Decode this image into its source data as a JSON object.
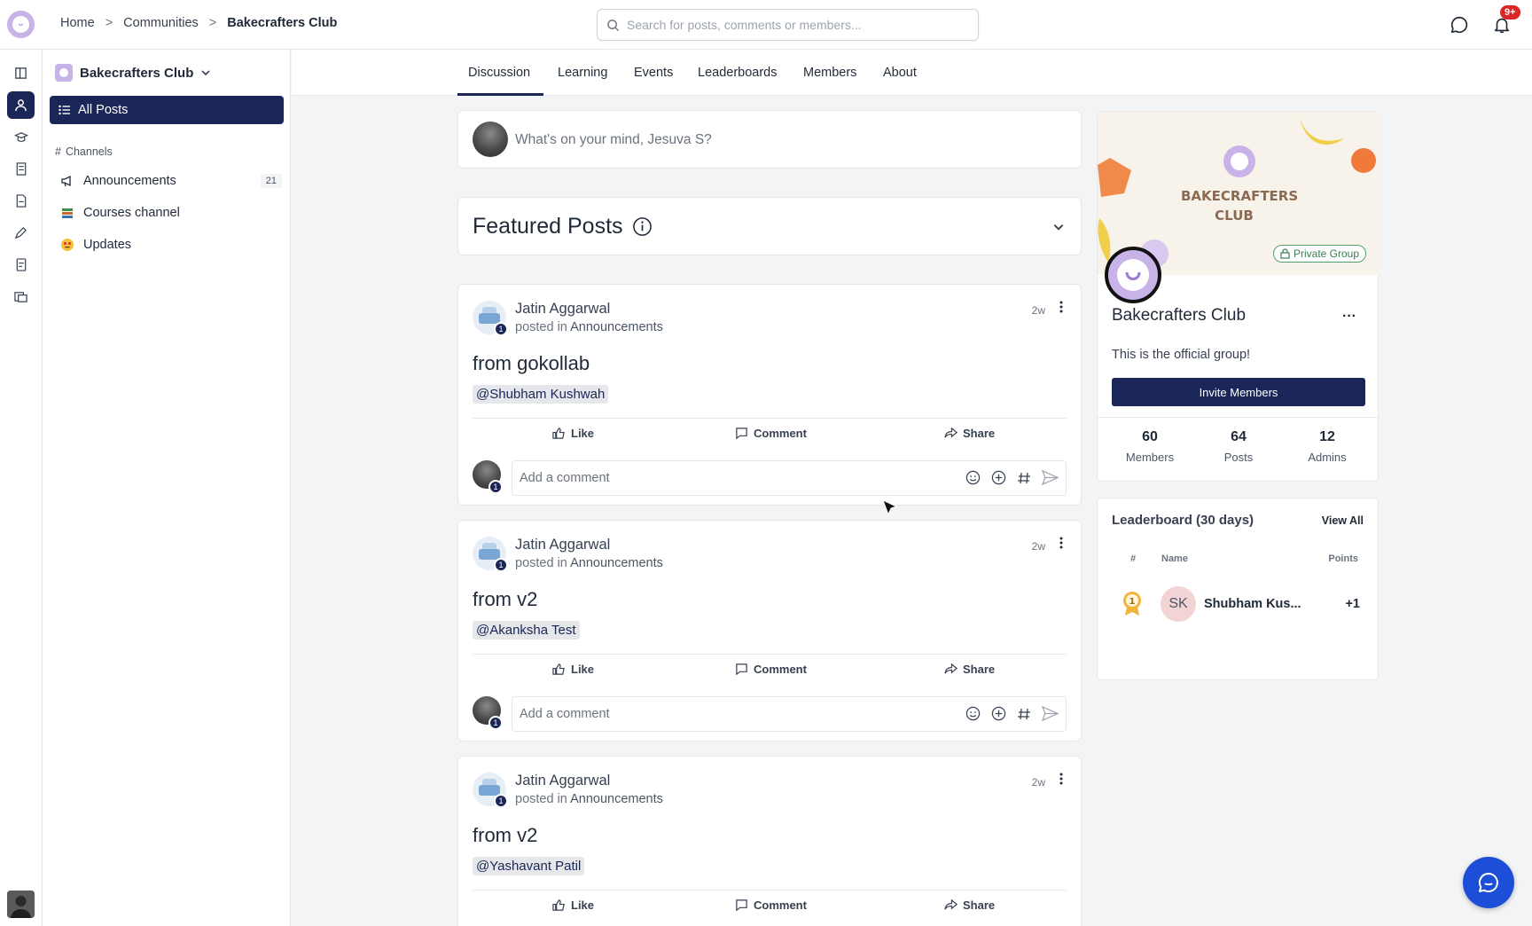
{
  "breadcrumb": {
    "home": "Home",
    "sep1": ">",
    "communities": "Communities",
    "sep2": ">",
    "current": "Bakecrafters Club"
  },
  "search": {
    "placeholder": "Search for posts, comments or members..."
  },
  "notifications": {
    "badge": "9+"
  },
  "sidebar": {
    "club_name": "Bakecrafters Club",
    "all_posts": "All Posts",
    "channels_heading": "Channels",
    "channels": [
      {
        "label": "Announcements",
        "count": "21",
        "icon": "megaphone-icon"
      },
      {
        "label": "Courses channel",
        "count": "",
        "icon": "books-icon"
      },
      {
        "label": "Updates",
        "count": "",
        "icon": "heart-eyes-emoji-icon"
      }
    ]
  },
  "tabs": [
    "Discussion",
    "Learning",
    "Events",
    "Leaderboards",
    "Members",
    "About"
  ],
  "composer": {
    "placeholder": "What's on your mind, Jesuva S?"
  },
  "featured": {
    "title": "Featured Posts"
  },
  "posts": [
    {
      "author": "Jatin Aggarwal",
      "posted_in": "posted in",
      "channel": "Announcements",
      "age": "2w",
      "title": "from gokollab",
      "mention": "@Shubham Kushwah",
      "level": "1"
    },
    {
      "author": "Jatin Aggarwal",
      "posted_in": "posted in",
      "channel": "Announcements",
      "age": "2w",
      "title": "from v2",
      "mention": "@Akanksha Test",
      "level": "1"
    },
    {
      "author": "Jatin Aggarwal",
      "posted_in": "posted in",
      "channel": "Announcements",
      "age": "2w",
      "title": "from v2",
      "mention": "@Yashavant Patil",
      "level": "1"
    }
  ],
  "post_actions": {
    "like": "Like",
    "comment": "Comment",
    "share": "Share",
    "comment_placeholder": "Add a comment",
    "commenter_level": "1"
  },
  "group": {
    "cover_text_line1": "BAKECRAFTERS",
    "cover_text_line2": "CLUB",
    "privacy": "Private Group",
    "name": "Bakecrafters Club",
    "description": "This is the official group!",
    "invite": "Invite Members",
    "more": "···",
    "stats": [
      {
        "value": "60",
        "label": "Members"
      },
      {
        "value": "64",
        "label": "Posts"
      },
      {
        "value": "12",
        "label": "Admins"
      }
    ]
  },
  "leaderboard": {
    "title": "Leaderboard (30 days)",
    "view_all": "View All",
    "col_rank": "#",
    "col_name": "Name",
    "col_points": "Points",
    "entries": [
      {
        "rank": "1",
        "initials": "SK",
        "name": "Shubham Kus...",
        "points": "+1"
      }
    ]
  },
  "colors": {
    "primary": "#1a2657",
    "badge": "#dc2626",
    "fab": "#1d4ed8"
  }
}
